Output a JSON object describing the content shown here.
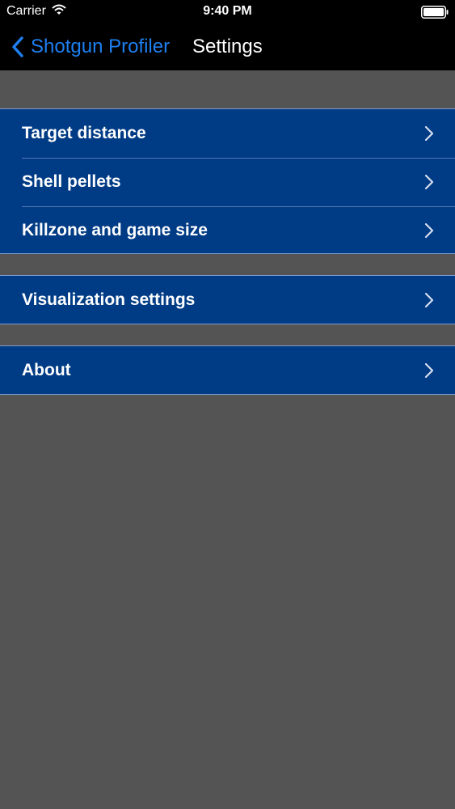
{
  "status_bar": {
    "carrier": "Carrier",
    "time": "9:40 PM",
    "wifi_icon": "wifi-icon",
    "battery_icon": "battery-full-icon"
  },
  "nav_bar": {
    "back_label": "Shotgun Profiler",
    "back_icon": "chevron-left-icon",
    "title": "Settings"
  },
  "colors": {
    "accent": "#1e7ff0",
    "cell_background": "#003b85",
    "page_background": "#545454",
    "nav_background": "#000000"
  },
  "groups": [
    {
      "rows": [
        {
          "label": "Target distance",
          "icon": "chevron-right-icon"
        },
        {
          "label": "Shell pellets",
          "icon": "chevron-right-icon"
        },
        {
          "label": "Killzone and game size",
          "icon": "chevron-right-icon"
        }
      ]
    },
    {
      "rows": [
        {
          "label": "Visualization settings",
          "icon": "chevron-right-icon"
        }
      ]
    },
    {
      "rows": [
        {
          "label": "About",
          "icon": "chevron-right-icon"
        }
      ]
    }
  ]
}
